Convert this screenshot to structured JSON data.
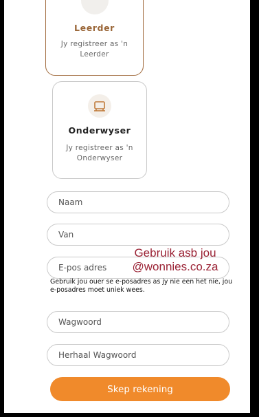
{
  "roles": [
    {
      "title": "Leerder",
      "description": "Jy registreer as 'n Leerder",
      "icon": "student-icon",
      "selected": true
    },
    {
      "title": "Onderwyser",
      "description": "Jy registreer as 'n Onderwyser",
      "icon": "whiteboard-icon",
      "selected": false
    }
  ],
  "form": {
    "first_name_placeholder": "Naam",
    "surname_placeholder": "Van",
    "email_placeholder": "E-pos adres",
    "email_note": "Gebruik asb jou @wonnies.co.za",
    "email_hint": "Gebruik jou ouer se e-posadres as jy nie een het nie, jou e-posadres moet uniek wees.",
    "password_placeholder": "Wagwoord",
    "repeat_password_placeholder": "Herhaal Wagwoord",
    "submit_label": "Skep rekening"
  },
  "colors": {
    "accent": "#F08A2B",
    "selected_border": "#A06A3C",
    "note_text": "#9B2335"
  }
}
